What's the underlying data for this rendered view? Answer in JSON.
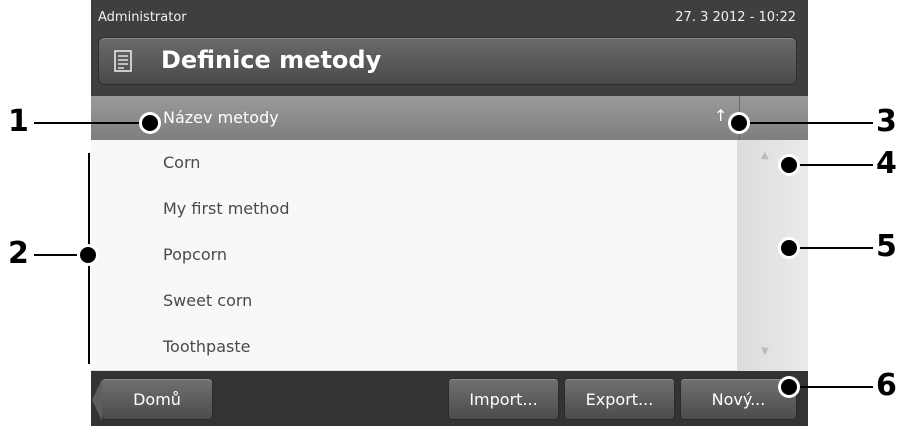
{
  "statusbar": {
    "user": "Administrator",
    "datetime": "27. 3 2012 - 10:22"
  },
  "titlebar": {
    "title": "Definice metody",
    "icon": "method-definition-icon"
  },
  "list": {
    "column_header": "Název metody",
    "sort_indicator": "↑",
    "items": [
      {
        "label": "Corn"
      },
      {
        "label": "My first method"
      },
      {
        "label": "Popcorn"
      },
      {
        "label": "Sweet corn"
      },
      {
        "label": "Toothpaste"
      }
    ]
  },
  "buttons": {
    "home": "Domů",
    "import": "Import...",
    "export": "Export...",
    "new": "Nový..."
  },
  "callouts": {
    "c1": "1",
    "c2": "2",
    "c3": "3",
    "c4": "4",
    "c5": "5",
    "c6": "6"
  }
}
